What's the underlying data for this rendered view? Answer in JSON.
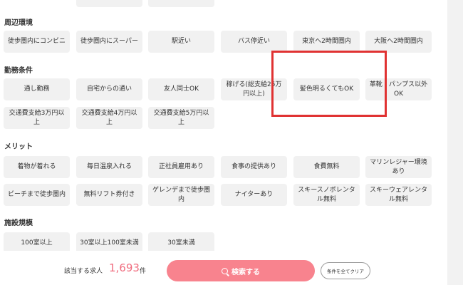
{
  "sections": {
    "surroundings": {
      "heading": "周辺環境",
      "items": [
        "徒歩圏内にコンビニ",
        "徒歩圏内にスーパー",
        "駅近い",
        "バス停近い",
        "東京へ2時間圏内",
        "大阪へ2時間圏内"
      ]
    },
    "work_conditions": {
      "heading": "勤務条件",
      "items": [
        "通し勤務",
        "自宅からの通い",
        "友人同士OK",
        "稼げる(総支給25万円以上)",
        "髪色明るくてもOK",
        "革靴・パンプス以外OK",
        "交通費支給3万円以上",
        "交通費支給4万円以上",
        "交通費支給5万円以上"
      ]
    },
    "merits": {
      "heading": "メリット",
      "items": [
        "着物が着れる",
        "毎日温泉入れる",
        "正社員雇用あり",
        "食事の提供あり",
        "食費無料",
        "マリンレジャー環境あり",
        "ビーチまで徒歩圏内",
        "無料リフト券付き",
        "ゲレンデまで徒歩圏内",
        "ナイターあり",
        "スキースノボレンタル無料",
        "スキーウェアレンタル無料"
      ]
    },
    "facility_size": {
      "heading": "施設規模",
      "items": [
        "100室以上",
        "30室以上100室未満",
        "30室未満"
      ]
    }
  },
  "footer": {
    "result_label": "該当する求人",
    "result_count": "1,693",
    "result_unit": "件",
    "search_label": "検索する",
    "clear_label": "条件を全てクリア"
  },
  "colors": {
    "accent": "#f8838e",
    "count": "#f06d7f",
    "highlight": "#e03232",
    "chip_bg": "#f1f1f1"
  }
}
